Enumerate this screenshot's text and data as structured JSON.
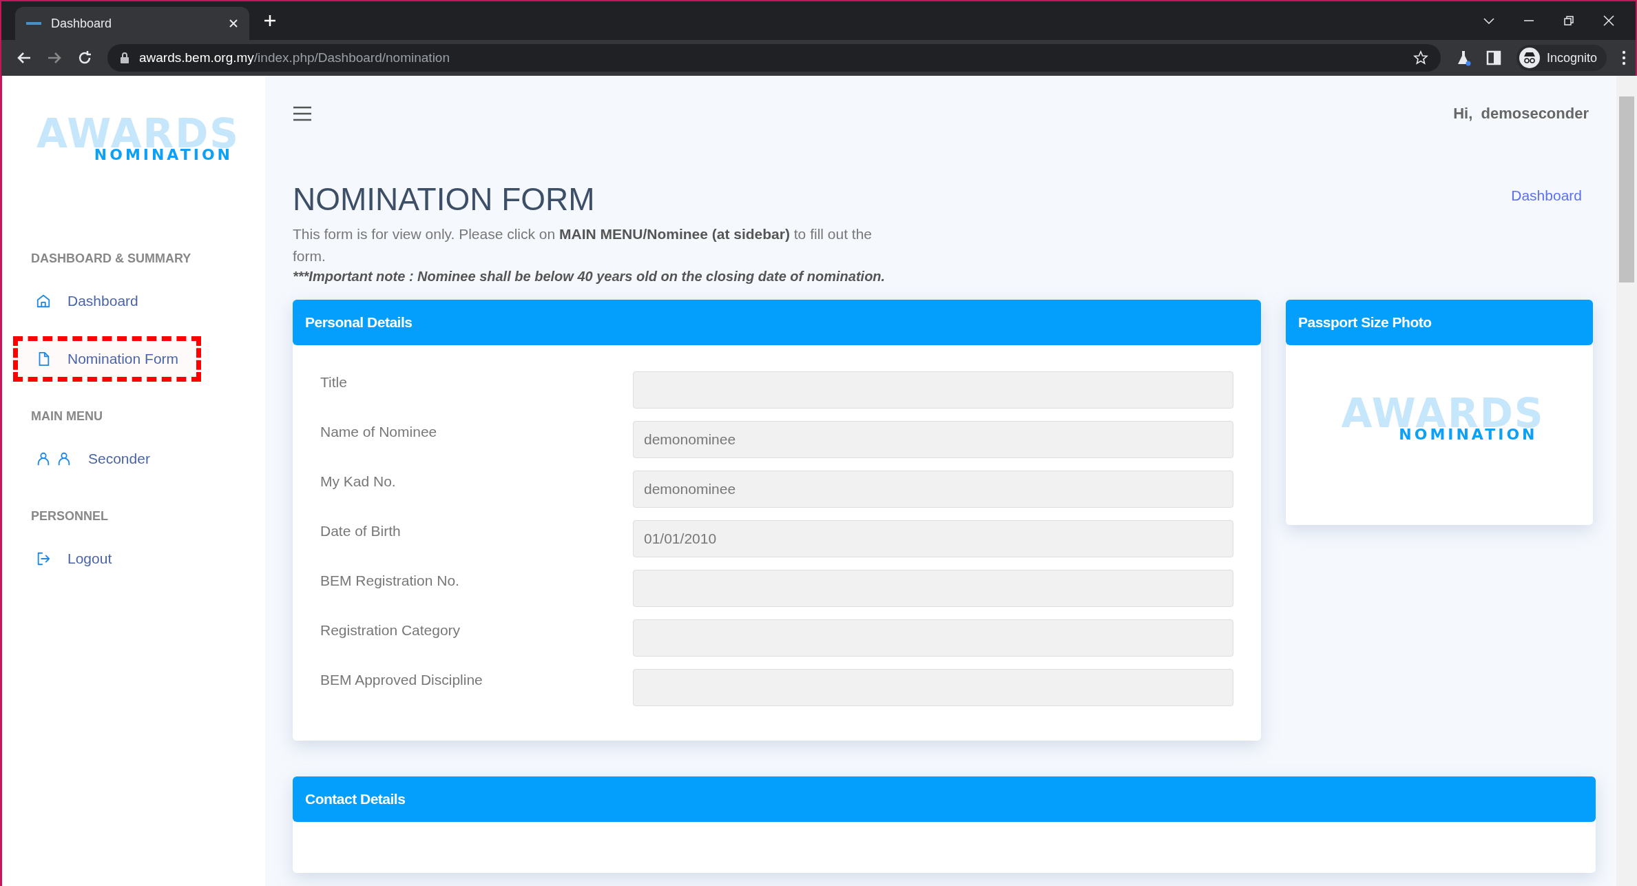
{
  "browser": {
    "tab_title": "Dashboard",
    "url_host": "awards.bem.org.my",
    "url_path": "/index.php/Dashboard/nomination",
    "profile": "Incognito"
  },
  "sidebar": {
    "logo": {
      "word": "AWARDS",
      "subtitle": "NOMINATION"
    },
    "sections": [
      {
        "heading": "DASHBOARD & SUMMARY",
        "items": [
          {
            "label": "Dashboard",
            "kind": "home",
            "highlighted": false
          },
          {
            "label": "Nomination Form",
            "kind": "file",
            "highlighted": true
          }
        ]
      },
      {
        "heading": "MAIN MENU",
        "items": [
          {
            "label": "Seconder",
            "kind": "users",
            "highlighted": false
          }
        ]
      },
      {
        "heading": "PERSONNEL",
        "items": [
          {
            "label": "Logout",
            "kind": "logout",
            "highlighted": false
          }
        ]
      }
    ]
  },
  "header": {
    "greeting": "Hi,  demoseconder"
  },
  "page": {
    "title": "NOMINATION FORM",
    "breadcrumb": "Dashboard",
    "description": "This form is for view only. Please click on **MAIN MENU/Nominee (at sidebar)** to fill out the form.",
    "note": "***Important note : Nominee shall be below 40 years old on the closing date of nomination."
  },
  "personal_details": {
    "title": "Personal Details",
    "fields": [
      {
        "label": "Title"
      },
      {
        "label": "Name of Nominee",
        "value": "demonominee"
      },
      {
        "label": "My Kad No.",
        "value": "demonominee"
      },
      {
        "label": "Date of Birth",
        "value": "01/01/2010"
      },
      {
        "label": "BEM Registration No."
      },
      {
        "label": "Registration Category"
      },
      {
        "label": "BEM Approved Discipline"
      }
    ]
  },
  "photo": {
    "title": "Passport Size Photo",
    "logo": {
      "word": "AWARDS",
      "subtitle": "NOMINATION"
    }
  },
  "contact_details": {
    "title": "Contact Details"
  }
}
